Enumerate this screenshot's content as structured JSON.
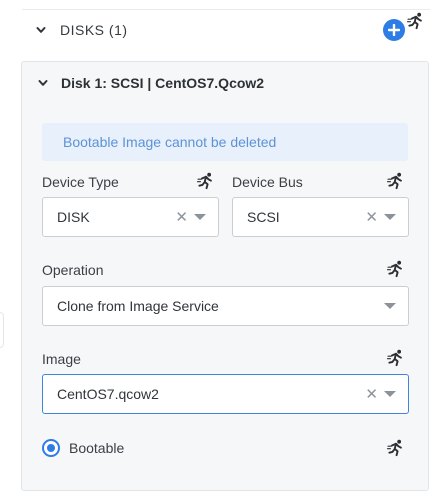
{
  "disks_section": {
    "title": "DISKS (1)",
    "expand_icon": "chevron-down-icon",
    "add_icon": "plus-icon",
    "runtime_icon": "running-man-icon"
  },
  "disk": {
    "title": "Disk 1: SCSI | CentOS7.Qcow2",
    "info_message": "Bootable Image cannot be deleted",
    "device_type": {
      "label": "Device Type",
      "value": "DISK"
    },
    "device_bus": {
      "label": "Device Bus",
      "value": "SCSI"
    },
    "operation": {
      "label": "Operation",
      "value": "Clone from Image Service"
    },
    "image": {
      "label": "Image",
      "value": "CentOS7.qcow2"
    },
    "bootable": {
      "label": "Bootable",
      "checked": true
    }
  },
  "colors": {
    "accent": "#2e7ce5",
    "info_bg": "#e7f0fb",
    "info_text": "#5d92d6",
    "panel_bg": "#f6f7f9"
  }
}
